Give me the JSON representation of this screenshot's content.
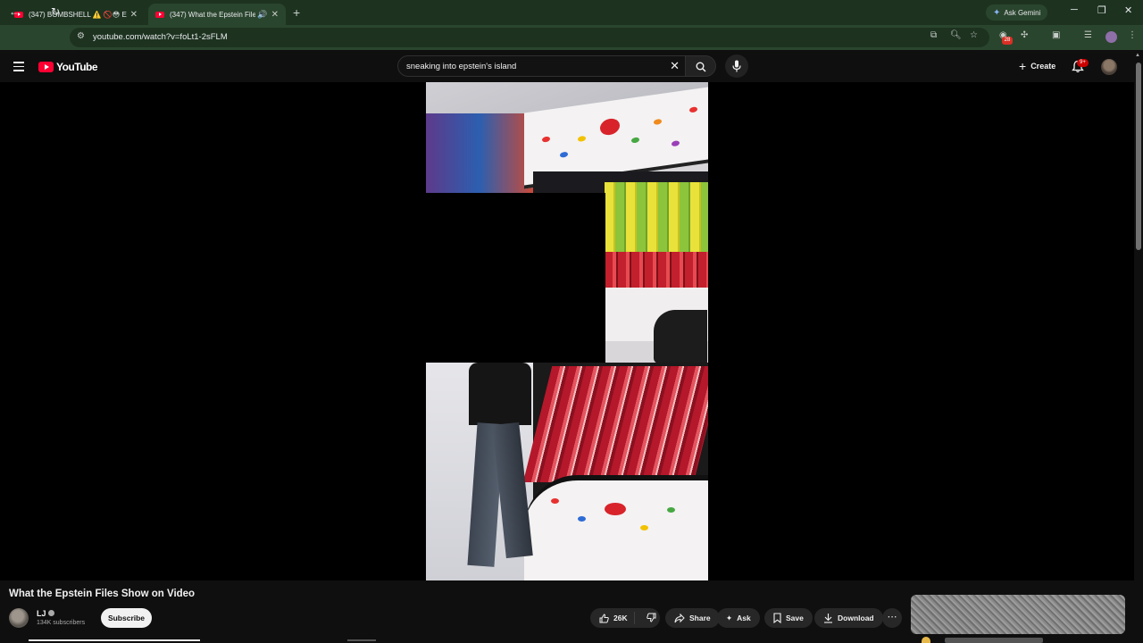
{
  "browser": {
    "tabs": [
      {
        "title": "(347) BOMBSHELL ⚠️ 🚫😳 Ep..."
      },
      {
        "title": "(347) What the Epstein File..."
      }
    ],
    "new_tab": "+",
    "gemini_label": "Ask Gemini",
    "url": "youtube.com/watch?v=foLt1-2sFLM",
    "extension_badge": "28"
  },
  "youtube": {
    "logo": "YouTube",
    "search": {
      "query": "sneaking into epstein's island"
    },
    "create_label": "Create",
    "notification_count": "9+"
  },
  "video": {
    "title": "What the Epstein Files Show on Video",
    "channel": {
      "name": "LJ",
      "subscribers": "134K subscribers"
    },
    "subscribe_label": "Subscribe",
    "actions": {
      "likes": "26K",
      "share": "Share",
      "ask": "Ask",
      "save": "Save",
      "download": "Download"
    }
  },
  "colors": {
    "brand_red": "#ff0033",
    "page_bg": "#0f0f0f",
    "chrome_bg": "#2a452d"
  }
}
